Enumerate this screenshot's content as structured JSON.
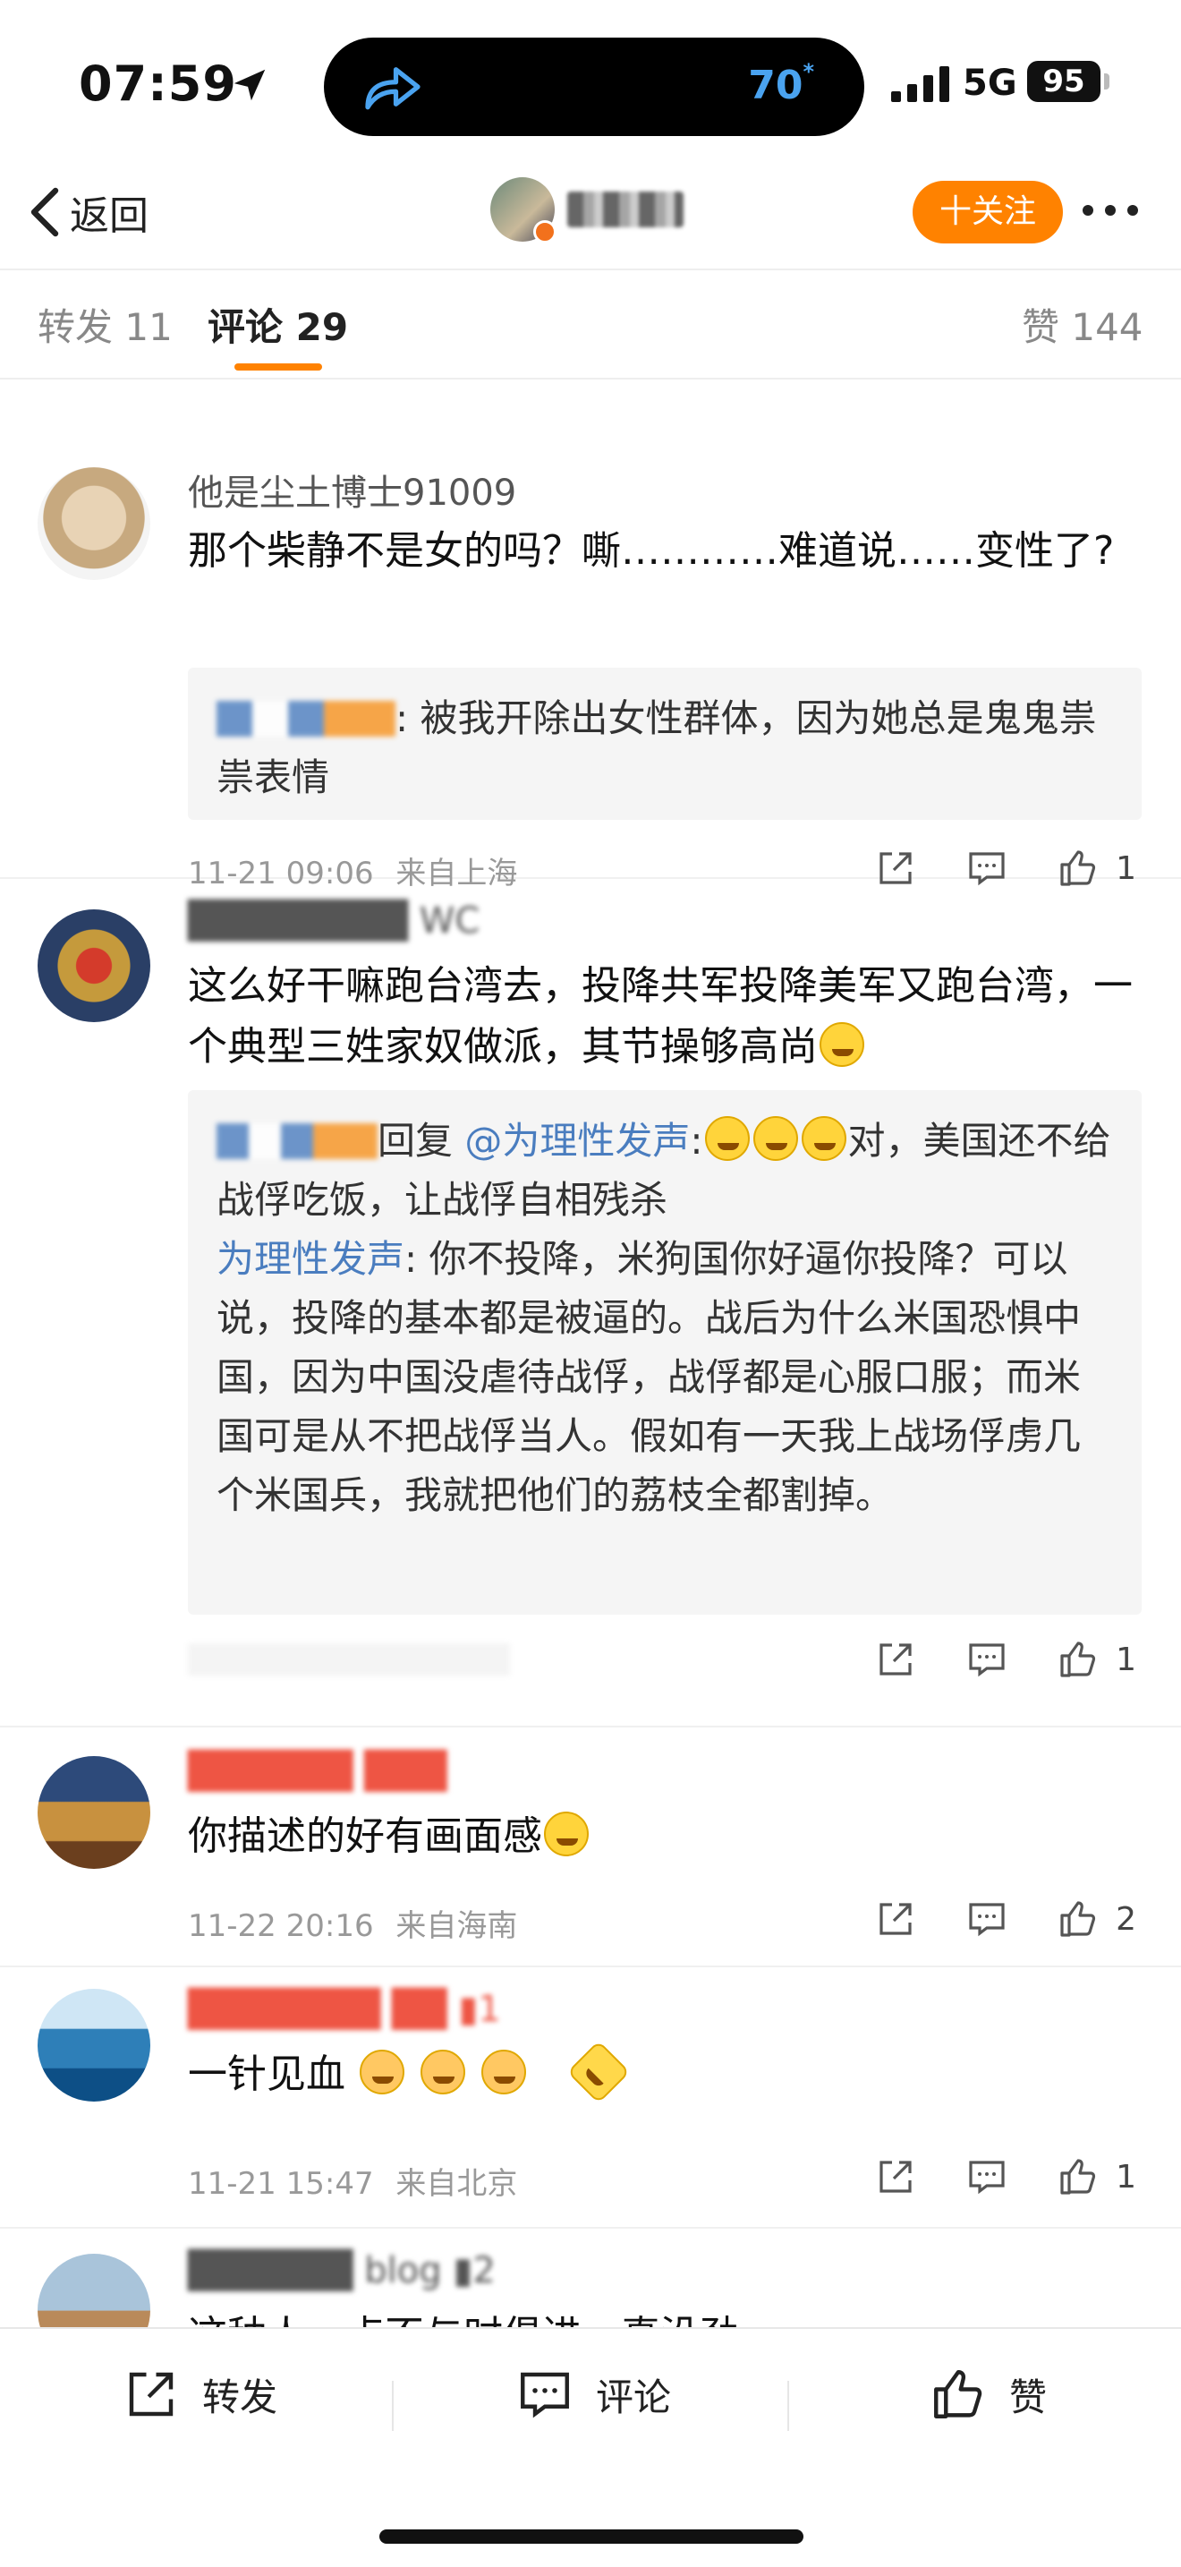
{
  "status": {
    "time": "07:59",
    "island_number": "70",
    "island_sup": "*",
    "network": "5G",
    "battery": "95"
  },
  "nav": {
    "back_label": "返回",
    "follow_label": "十关注"
  },
  "tabs": {
    "repost": "转发 11",
    "comment": "评论 29",
    "likes": "赞 144"
  },
  "comments": [
    {
      "name": "他是尘土博士91009",
      "text": "那个柴静不是女的吗？嘶…………难道说……变性了?",
      "reply": ": 被我开除出女性群体，因为她总是鬼鬼祟祟表情",
      "time": "11-21 09:06",
      "location": "来自上海",
      "likes": "1"
    },
    {
      "text_a": "这么好干嘛跑台湾去，投降共军投降美军又跑台湾，一个典型三姓家奴做派，其节操够高尚",
      "reply1_mid": "回复",
      "reply1_target": "@为理性发声",
      "reply1_text": "对，美国还不给战俘吃饭，让战俘自相残杀",
      "reply2_name": "为理性发声",
      "reply2_text": ": 你不投降，米狗国你好逼你投降？可以说，投降的基本都是被逼的。战后为什么米国恐惧中国，因为中国没虐待战俘，战俘都是心服口服；而米国可是从不把战俘当人。假如有一天我上战场俘虏几个米国兵，我就把他们的荔枝全都割掉。",
      "likes": "1"
    },
    {
      "text": "你描述的好有画面感",
      "time": "11-22 20:16",
      "location": "来自海南",
      "likes": "2"
    },
    {
      "text": "一针见血",
      "time": "11-21 15:47",
      "location": "来自北京",
      "likes": "1"
    },
    {
      "text": "这种人一点不与时俱进，真没劲"
    }
  ],
  "bottom": {
    "repost": "转发",
    "comment": "评论",
    "like": "赞"
  },
  "colors": {
    "accent": "#ff8200",
    "link": "#4a7dbf"
  }
}
